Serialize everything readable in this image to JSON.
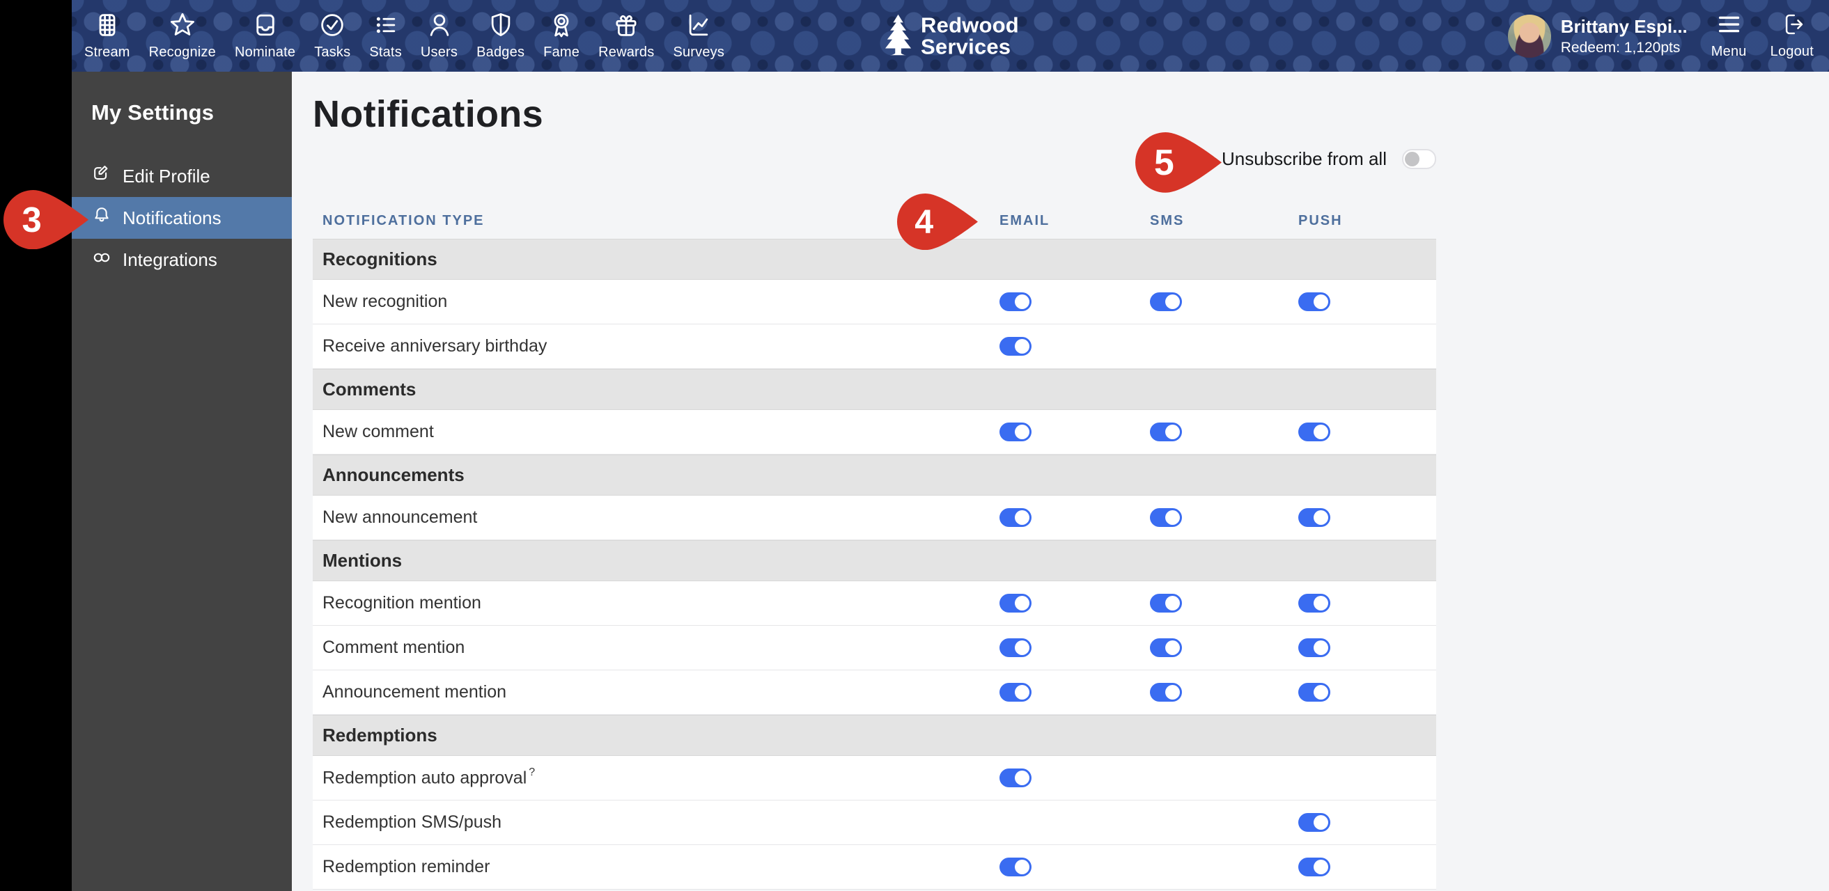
{
  "topnav": {
    "items": [
      {
        "label": "Stream",
        "icon": "grid-icon"
      },
      {
        "label": "Recognize",
        "icon": "star-icon"
      },
      {
        "label": "Nominate",
        "icon": "inbox-icon"
      },
      {
        "label": "Tasks",
        "icon": "circle-check-icon"
      },
      {
        "label": "Stats",
        "icon": "list-icon"
      },
      {
        "label": "Users",
        "icon": "user-icon"
      },
      {
        "label": "Badges",
        "icon": "shield-icon"
      },
      {
        "label": "Fame",
        "icon": "award-icon"
      },
      {
        "label": "Rewards",
        "icon": "gift-icon"
      },
      {
        "label": "Surveys",
        "icon": "chart-icon"
      }
    ],
    "logo": {
      "line1": "Redwood",
      "line2": "Services",
      "icon": "tree-icon"
    },
    "user": {
      "name": "Brittany Espi...",
      "redeem": "Redeem: 1,120pts"
    },
    "menu_label": "Menu",
    "logout_label": "Logout"
  },
  "sidebar": {
    "title": "My Settings",
    "items": [
      {
        "label": "Edit Profile",
        "icon": "edit-icon",
        "active": false
      },
      {
        "label": "Notifications",
        "icon": "bell-icon",
        "active": true
      },
      {
        "label": "Integrations",
        "icon": "link-icon",
        "active": false
      }
    ]
  },
  "main": {
    "title": "Notifications",
    "unsubscribe_label": "Unsubscribe from all",
    "unsubscribe_on": false,
    "columns": [
      "NOTIFICATION TYPE",
      "EMAIL",
      "SMS",
      "PUSH"
    ],
    "sections": [
      {
        "name": "Recognitions",
        "rows": [
          {
            "label": "New recognition",
            "email": true,
            "sms": true,
            "push": true
          },
          {
            "label": "Receive anniversary birthday",
            "email": true,
            "sms": null,
            "push": null
          }
        ]
      },
      {
        "name": "Comments",
        "rows": [
          {
            "label": "New comment",
            "email": true,
            "sms": true,
            "push": true
          }
        ]
      },
      {
        "name": "Announcements",
        "rows": [
          {
            "label": "New announcement",
            "email": true,
            "sms": true,
            "push": true
          }
        ]
      },
      {
        "name": "Mentions",
        "rows": [
          {
            "label": "Recognition mention",
            "email": true,
            "sms": true,
            "push": true
          },
          {
            "label": "Comment mention",
            "email": true,
            "sms": true,
            "push": true
          },
          {
            "label": "Announcement mention",
            "email": true,
            "sms": true,
            "push": true
          }
        ]
      },
      {
        "name": "Redemptions",
        "rows": [
          {
            "label": "Redemption auto approval",
            "help": "?",
            "email": true,
            "sms": null,
            "push": null
          },
          {
            "label": "Redemption SMS/push",
            "email": null,
            "sms": null,
            "push": true
          },
          {
            "label": "Redemption reminder",
            "email": true,
            "sms": null,
            "push": true
          }
        ]
      }
    ]
  },
  "annotations": [
    {
      "number": "3",
      "target": "sidebar-notifications"
    },
    {
      "number": "4",
      "target": "email-column-header"
    },
    {
      "number": "5",
      "target": "unsubscribe-toggle"
    }
  ],
  "colors": {
    "topbar_navy": "#24386b",
    "sidebar_gray": "#434343",
    "active_item_blue": "#5379a9",
    "toggle_on_blue": "#3a6cf1",
    "column_header_blue": "#4e6f9d",
    "annotation_red": "#d63427",
    "section_band_gray": "#e4e4e4",
    "page_bg": "#f4f5f7"
  }
}
